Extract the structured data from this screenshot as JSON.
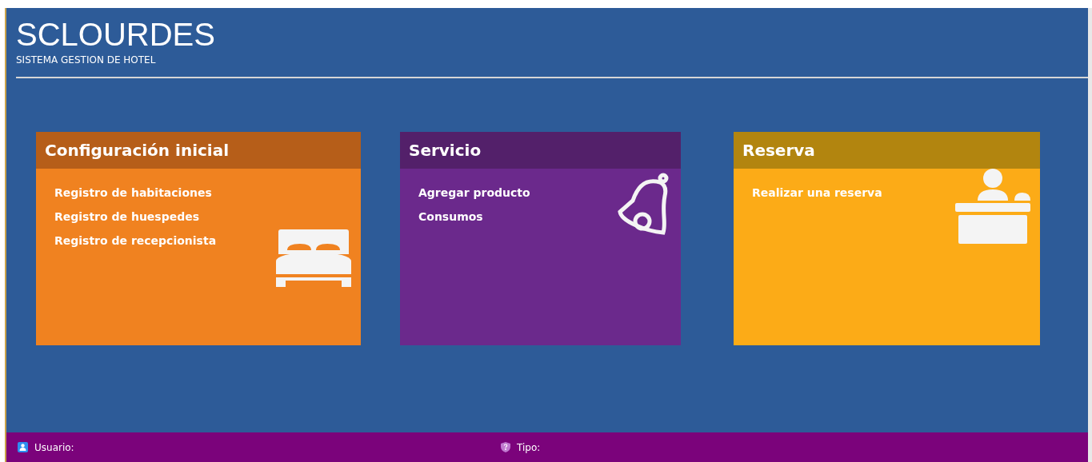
{
  "header": {
    "title": "SCLOURDES",
    "subtitle": "SISTEMA GESTION DE HOTEL"
  },
  "cards": [
    {
      "title": "Configuración inicial",
      "kind": "bed",
      "links": [
        "Registro de habitaciones",
        "Registro de huespedes",
        "Registro de recepcionista"
      ]
    },
    {
      "title": "Servicio",
      "kind": "bell",
      "links": [
        "Agregar producto",
        "Consumos"
      ]
    },
    {
      "title": "Reserva",
      "kind": "desk",
      "links": [
        "Realizar una reserva"
      ]
    }
  ],
  "status_bar": {
    "items": [
      {
        "label": "Usuario:",
        "kind": "user"
      },
      {
        "label": "Tipo:",
        "kind": "shield"
      }
    ]
  }
}
